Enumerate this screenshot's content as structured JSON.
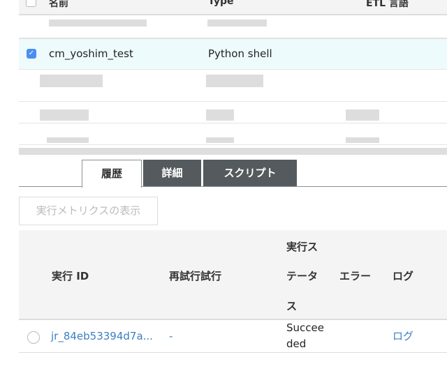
{
  "jobs_table": {
    "columns": [
      "名前",
      "Type",
      "ETL 言語"
    ],
    "selected_row": {
      "name": "cm_yoshim_test",
      "type": "Python shell",
      "checked": true
    }
  },
  "tabs": [
    {
      "label": "履歴",
      "active": true
    },
    {
      "label": "詳細",
      "active": false
    },
    {
      "label": "スクリプト",
      "active": false
    }
  ],
  "metrics_button": "実行メトリクスの表示",
  "history_table": {
    "columns": {
      "run_id": "実行 ID",
      "retry": "再試行試行",
      "status_1": "実行ス",
      "status_2": "テータ",
      "status_3": "ス",
      "error": "エラー",
      "log": "ログ"
    },
    "rows": [
      {
        "run_id": "jr_84eb53394d7a...",
        "retry": "-",
        "status_1": "Succee",
        "status_2": "ded",
        "log": "ログ"
      }
    ]
  },
  "colors": {
    "link": "#3a7fc4",
    "tab_dark": "#545a5d",
    "selected_bg": "#eefbfd",
    "checkbox": "#4a8ff0"
  }
}
